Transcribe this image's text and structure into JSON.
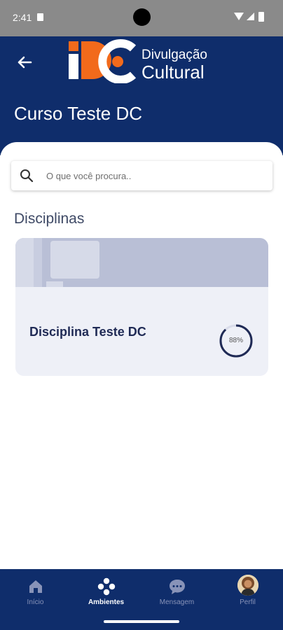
{
  "status_bar": {
    "time": "2:41"
  },
  "header": {
    "logo": {
      "mark": "DC",
      "line1": "Divulgação",
      "line2": "Cultural"
    },
    "title": "Curso Teste DC"
  },
  "search": {
    "placeholder": "O que você procura.."
  },
  "section": {
    "title": "Disciplinas"
  },
  "cards": [
    {
      "title": "Disciplina Teste DC",
      "progress_label": "88%",
      "progress": 0.88
    }
  ],
  "bottom_nav": [
    {
      "label": "Início",
      "icon": "home-icon",
      "active": false
    },
    {
      "label": "Ambientes",
      "icon": "apps-icon",
      "active": true
    },
    {
      "label": "Mensagem",
      "icon": "chat-icon",
      "active": false
    },
    {
      "label": "Perfil",
      "icon": "avatar",
      "active": false
    }
  ],
  "colors": {
    "primary": "#0f2d6b",
    "accent": "#f26a1b",
    "card_bg": "#eef0f7",
    "banner": "#b9bfd6"
  }
}
